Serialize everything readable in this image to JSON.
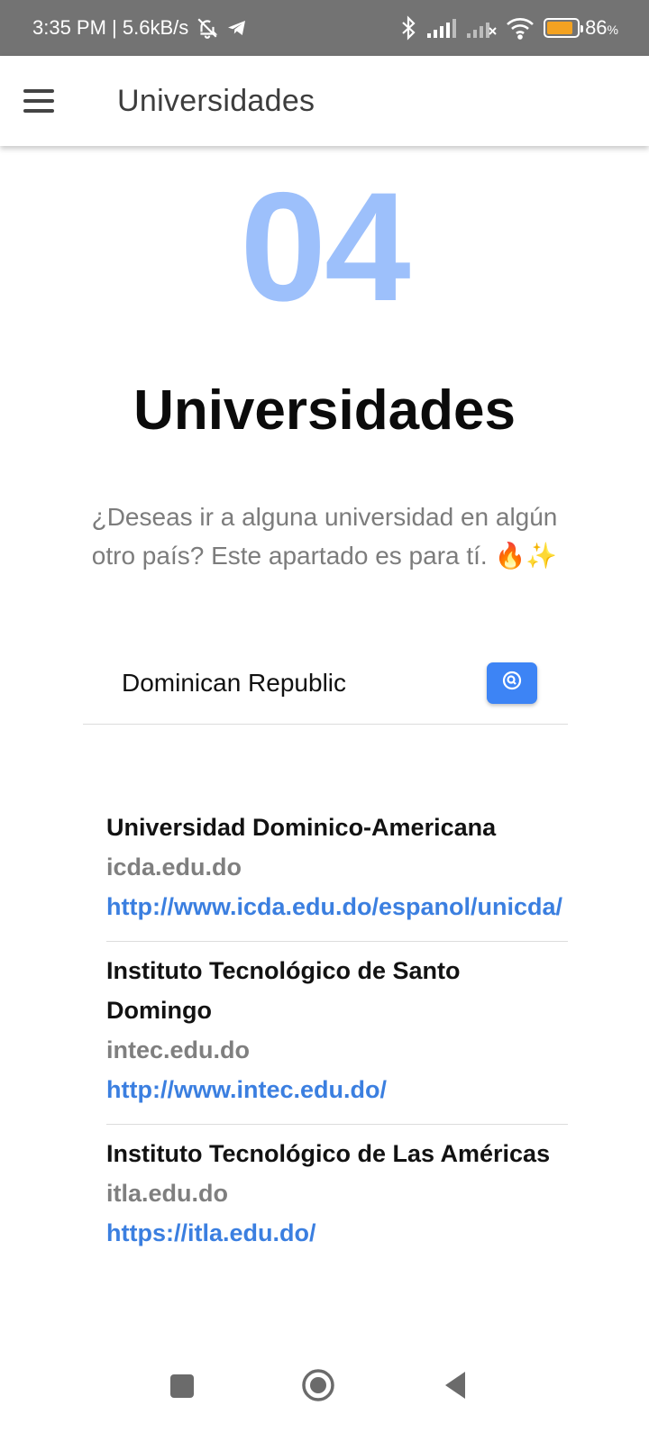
{
  "status_bar": {
    "time_speed": "3:35 PM | 5.6kB/s",
    "battery_percent": "86",
    "battery_unit": "%",
    "battery_level": 0.86,
    "battery_color": "#f3a221"
  },
  "app_bar": {
    "title": "Universidades",
    "menu_icon": "hamburger-menu-icon"
  },
  "hero": {
    "number": "04",
    "number_color": "#9dc0fb",
    "heading": "Universidades",
    "description": "¿Deseas ir a alguna universidad en algún otro país? Este apartado es para tí. 🔥✨"
  },
  "search": {
    "value": "Dominican Republic",
    "button_icon": "search-icon",
    "button_color": "#3d84f5"
  },
  "universities": [
    {
      "name": "Universidad Dominico-Americana",
      "domain": "icda.edu.do",
      "url": "http://www.icda.edu.do/espanol/unicda/"
    },
    {
      "name": "Instituto Tecnológico de Santo Domingo",
      "domain": "intec.edu.do",
      "url": "http://www.intec.edu.do/"
    },
    {
      "name": "Instituto Tecnológico de Las Américas",
      "domain": "itla.edu.do",
      "url": "https://itla.edu.do/"
    }
  ],
  "colors": {
    "link": "#3b7fe0",
    "domain": "#7f7f7f"
  }
}
